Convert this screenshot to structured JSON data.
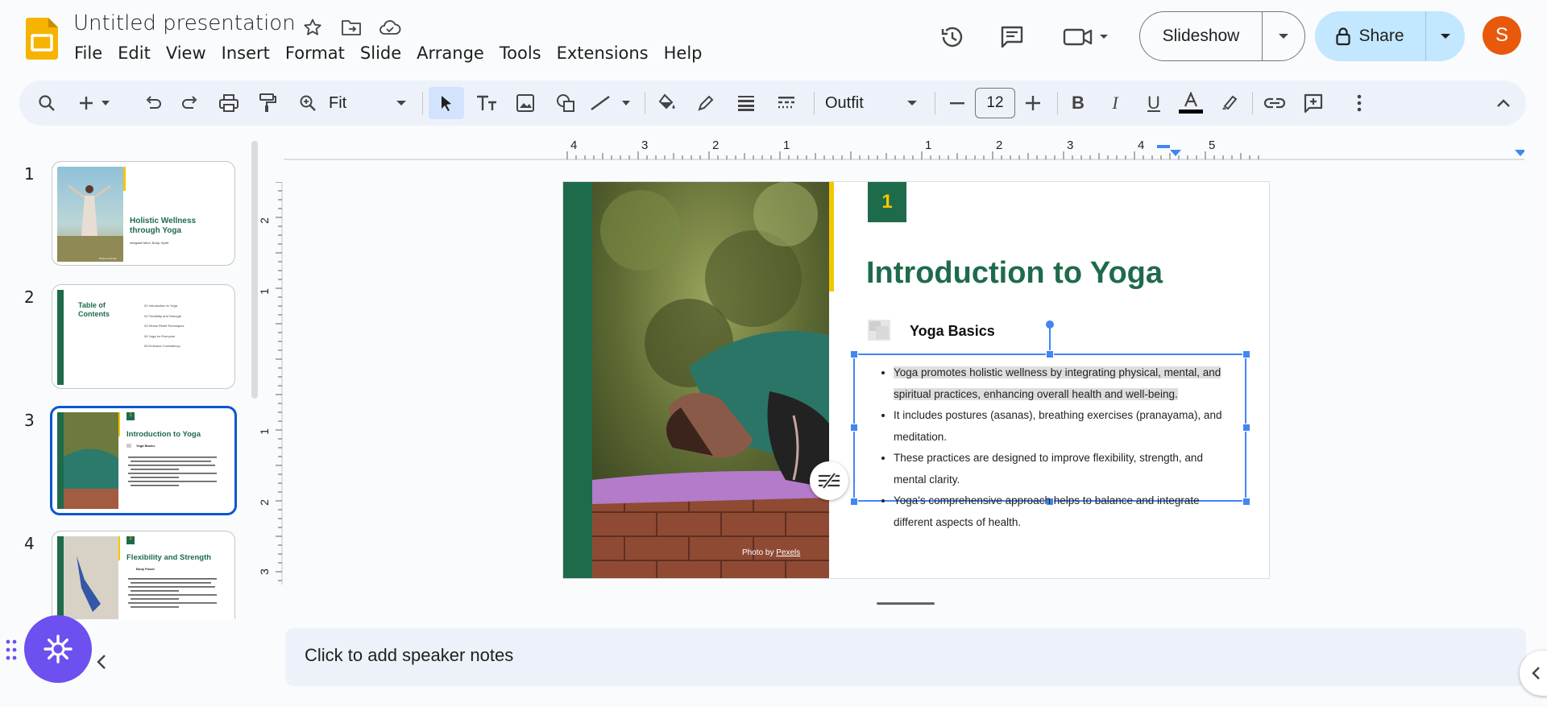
{
  "app": {
    "title": "Untitled presentation"
  },
  "menu": [
    "File",
    "Edit",
    "View",
    "Insert",
    "Format",
    "Slide",
    "Arrange",
    "Tools",
    "Extensions",
    "Help"
  ],
  "header": {
    "slideshow_label": "Slideshow",
    "share_label": "Share",
    "avatar_letter": "S"
  },
  "toolbar": {
    "zoom": "Fit",
    "font": "Outfit",
    "font_size": "12"
  },
  "filmstrip": {
    "numbers": [
      "1",
      "2",
      "3",
      "4"
    ],
    "slide1": {
      "title": "Holistic Wellness through Yoga",
      "subtitle": "Integrate Mind, Body, Spirit",
      "credit": "Photo by Pexels"
    },
    "slide2": {
      "title": "Table of Contents",
      "items": [
        "01 Introduction to Yoga",
        "02 Flexibility and Strength",
        "03 Stress Relief Techniques",
        "04 Yoga for Everyone",
        "05 Embrace Consistency"
      ]
    },
    "slide3": {
      "badge": "1",
      "title": "Introduction to Yoga",
      "subtitle": "Yoga Basics"
    },
    "slide4": {
      "badge": "2",
      "title": "Flexibility and Strength",
      "subtitle": "Body Power"
    }
  },
  "ruler": {
    "h_ticks": [
      "4",
      "3",
      "2",
      "1",
      "1",
      "2",
      "3",
      "4",
      "5"
    ],
    "v_ticks": [
      "2",
      "1",
      "1",
      "2",
      "3"
    ]
  },
  "slide": {
    "badge": "1",
    "title": "Introduction to Yoga",
    "subtitle": "Yoga Basics",
    "bullets": [
      "Yoga promotes holistic wellness by integrating physical, mental, and spiritual practices, enhancing overall health and well-being.",
      "It includes postures (asanas), breathing exercises (pranayama), and meditation.",
      "These practices are designed to improve flexibility, strength, and mental clarity.",
      "Yoga's comprehensive approach helps to balance and integrate different aspects of health."
    ],
    "photo_credit_prefix": "Photo by ",
    "photo_credit_link": "Pexels"
  },
  "notes": {
    "placeholder": "Click to add speaker notes"
  },
  "colors": {
    "green": "#1e6b4b",
    "yellow": "#f3c700",
    "accent": "#0b57d0",
    "share_bg": "#c2e7ff",
    "avatar": "#e8590c"
  }
}
